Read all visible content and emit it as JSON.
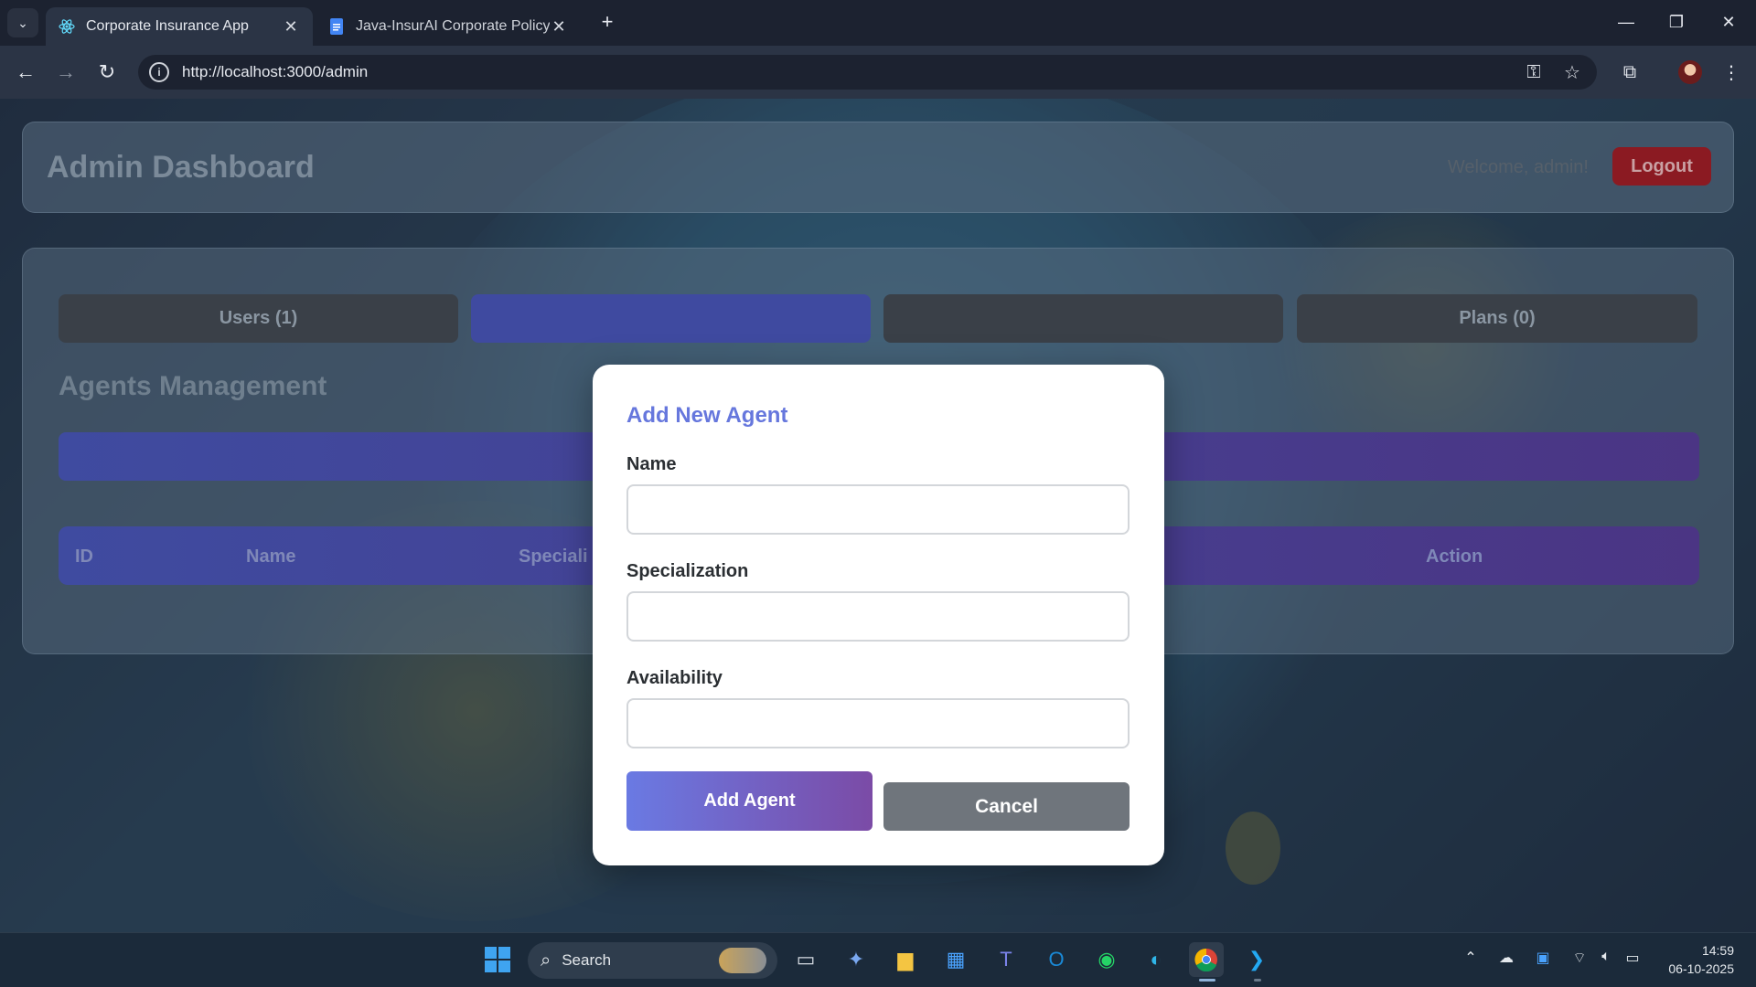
{
  "browser": {
    "tabs": [
      {
        "title": "Corporate Insurance App",
        "active": true
      },
      {
        "title": "Java-InsurAI Corporate Policy A",
        "active": false
      }
    ],
    "url": "http://localhost:3000/admin"
  },
  "header": {
    "title": "Admin Dashboard",
    "welcome": "Welcome, admin!",
    "logout_label": "Logout"
  },
  "tabs": [
    {
      "label": "Users (1)"
    },
    {
      "label": ""
    },
    {
      "label": ""
    },
    {
      "label": "Plans (0)"
    }
  ],
  "section": {
    "title": "Agents Management"
  },
  "table": {
    "headers": [
      "ID",
      "Name",
      "Speciali",
      "Action"
    ]
  },
  "modal": {
    "title": "Add New Agent",
    "fields": [
      {
        "label": "Name",
        "value": ""
      },
      {
        "label": "Specialization",
        "value": ""
      },
      {
        "label": "Availability",
        "value": ""
      }
    ],
    "add_label": "Add Agent",
    "cancel_label": "Cancel"
  },
  "taskbar": {
    "search_placeholder": "Search",
    "time": "14:59",
    "date": "06-10-2025"
  },
  "colors": {
    "accent": "#6677dd",
    "logout": "#8b1a22"
  }
}
